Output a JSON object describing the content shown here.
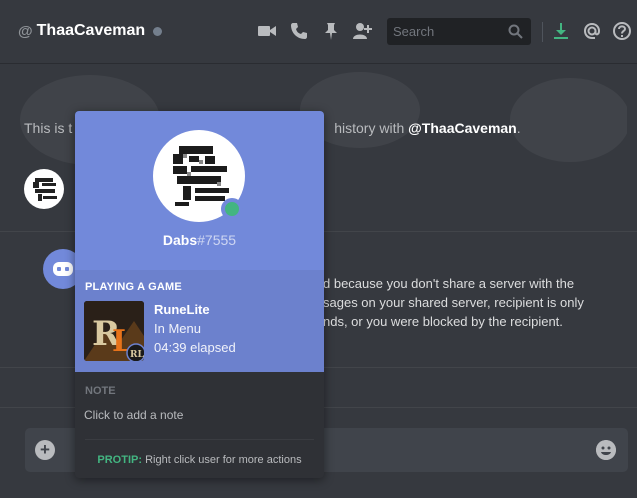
{
  "header": {
    "at_symbol": "@",
    "username": "ThaaCaveman",
    "search_placeholder": "Search"
  },
  "chat": {
    "welcome_prefix": "This is t",
    "welcome_suffix": "history with ",
    "welcome_user": "@ThaaCaveman",
    "welcome_end": ".",
    "system_lines": [
      "d because you don't share a server with the",
      "sages on your shared server, recipient is only",
      "nds, or you were blocked by the recipient."
    ]
  },
  "popout": {
    "name": "Dabs",
    "discriminator": "#7555",
    "activity_header": "PLAYING A GAME",
    "game_title": "RuneLite",
    "game_state": "In Menu",
    "game_elapsed": "04:39 elapsed",
    "note_header": "NOTE",
    "note_placeholder": "Click to add a note",
    "protip_label": "PROTIP:",
    "protip_text": " Right click user for more actions"
  },
  "colors": {
    "accent": "#7289da",
    "online": "#43b581",
    "background": "#36393f"
  },
  "icons": [
    "video-call-icon",
    "phone-call-icon",
    "pin-icon",
    "add-friend-icon",
    "search-icon",
    "download-icon",
    "mention-icon",
    "help-icon",
    "add-attachment-icon",
    "emoji-icon"
  ]
}
